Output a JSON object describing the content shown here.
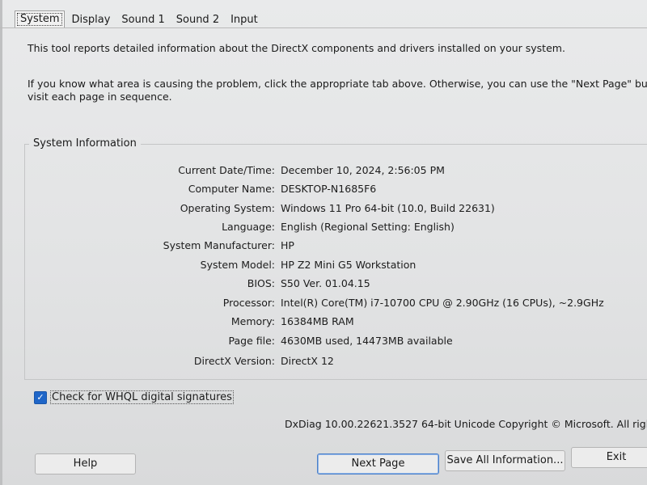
{
  "tabs": [
    "System",
    "Display",
    "Sound 1",
    "Sound 2",
    "Input"
  ],
  "intro": "This tool reports detailed information about the DirectX components and drivers installed on your system.",
  "hint_line1": "If you know what area is causing the problem, click the appropriate tab above.  Otherwise, you can use the \"Next Page\" button below to",
  "hint_line2": "visit each page in sequence.",
  "group_title": "System Information",
  "info": [
    {
      "label": "Current Date/Time:",
      "value": "December 10, 2024, 2:56:05 PM"
    },
    {
      "label": "Computer Name:",
      "value": "DESKTOP-N1685F6"
    },
    {
      "label": "Operating System:",
      "value": "Windows 11 Pro 64-bit (10.0, Build 22631)"
    },
    {
      "label": "Language:",
      "value": "English (Regional Setting: English)"
    },
    {
      "label": "System Manufacturer:",
      "value": "HP"
    },
    {
      "label": "System Model:",
      "value": "HP Z2 Mini G5 Workstation"
    },
    {
      "label": "BIOS:",
      "value": "S50 Ver. 01.04.15"
    },
    {
      "label": "Processor:",
      "value": "Intel(R) Core(TM) i7-10700 CPU @ 2.90GHz (16 CPUs), ~2.9GHz"
    },
    {
      "label": "Memory:",
      "value": "16384MB RAM"
    },
    {
      "label": "Page file:",
      "value": "4630MB used, 14473MB available"
    },
    {
      "label": "DirectX Version:",
      "value": "DirectX 12"
    }
  ],
  "whql": {
    "label": "Check for WHQL digital signatures",
    "checked": true,
    "check_mark": "✓"
  },
  "version": "DxDiag 10.00.22621.3527 64-bit Unicode  Copyright © Microsoft. All rights reserved.",
  "buttons": {
    "help": "Help",
    "next": "Next Page",
    "save": "Save All Information...",
    "exit": "Exit"
  },
  "colors": {
    "checkbox": "#1f66c8",
    "focus_border": "#4a7fc8"
  }
}
